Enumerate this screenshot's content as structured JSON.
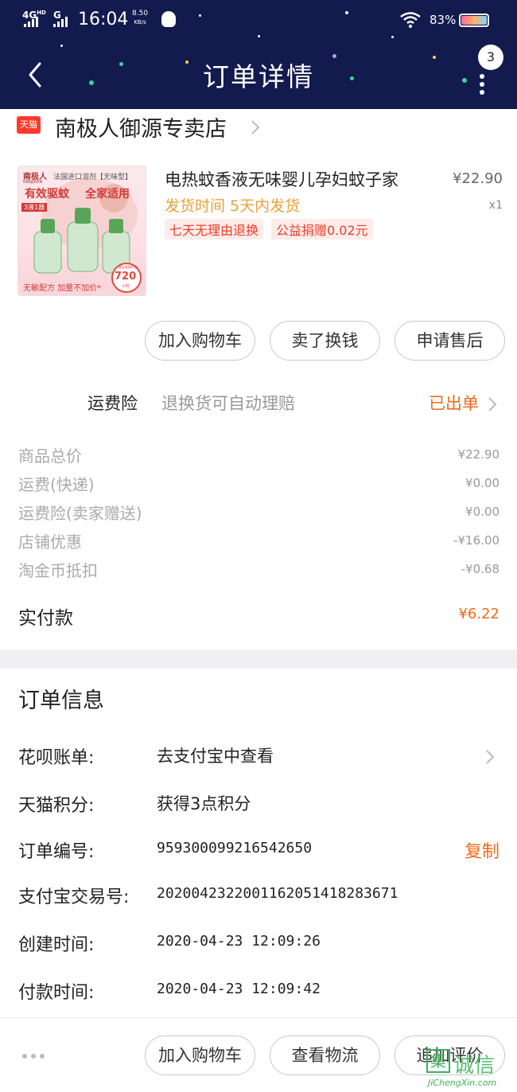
{
  "status_bar": {
    "network": "4G",
    "network2": "G",
    "time": "16:04",
    "speed_value": "8.50",
    "speed_unit": "KB/s",
    "battery": "83%",
    "icons": [
      "signal-icon",
      "qq-icon",
      "wifi-icon",
      "battery-icon"
    ]
  },
  "header": {
    "title": "订单详情",
    "message_count": "3",
    "back_icon": "chevron-left-icon",
    "more_icon": "more-vertical-icon"
  },
  "shop": {
    "badge": "天猫",
    "name": "南极人御源专卖店"
  },
  "product": {
    "name": "电热蚊香液无味婴儿孕妇蚊子家",
    "price": "¥22.90",
    "qty": "x1",
    "ship_time": "发货时间 5天内发货",
    "tags": [
      "七天无理由退换",
      "公益捐赠0.02元"
    ],
    "image": {
      "brand": "南极人",
      "subbrand": "NANJIREN",
      "top_note": "法国进口溶剂【无味型】",
      "slogan1": "有效驱蚊",
      "slogan2": "全家适用",
      "pack": "3液1器",
      "bottom_note": "无敏配方 加量不加价*",
      "hours": "720",
      "hours_unit": "小时",
      "hours_caption": "超长驱蚊时长"
    }
  },
  "actions_top": [
    "加入购物车",
    "卖了换钱",
    "申请售后"
  ],
  "insurance": {
    "label": "运费险",
    "desc": "退换货可自动理赔",
    "status": "已出单"
  },
  "price_breakdown": [
    {
      "label": "商品总价",
      "value": "¥22.90"
    },
    {
      "label": "运费(快递)",
      "value": "¥0.00"
    },
    {
      "label": "运费险(卖家赠送)",
      "value": "¥0.00"
    },
    {
      "label": "店铺优惠",
      "value": "-¥16.00"
    },
    {
      "label": "淘金币抵扣",
      "value": "-¥0.68"
    }
  ],
  "paid": {
    "label": "实付款",
    "value": "¥6.22"
  },
  "order_info": {
    "title": "订单信息",
    "rows": [
      {
        "label": "花呗账单:",
        "value": "去支付宝中查看"
      },
      {
        "label": "天猫积分:",
        "value": "获得3点积分"
      },
      {
        "label": "订单编号:",
        "value": "959300099216542650",
        "action": "复制"
      },
      {
        "label": "支付宝交易号:",
        "value": "2020042322001162051418283671"
      },
      {
        "label": "创建时间:",
        "value": "2020-04-23 12:09:26"
      },
      {
        "label": "付款时间:",
        "value": "2020-04-23 12:09:42"
      }
    ]
  },
  "actions_bottom": [
    "加入购物车",
    "查看物流",
    "追加评价"
  ],
  "watermark": {
    "mark": "集",
    "text": "诚信",
    "domain": "JiChengXin.com"
  },
  "colors": {
    "header_bg": "#131a4e",
    "accent_orange": "#ee6a1d",
    "tmall_red": "#ff3a2c",
    "ship_orange": "#e8a23a",
    "tag_red": "#ee3f2a",
    "watermark_green": "#3cb35a"
  }
}
